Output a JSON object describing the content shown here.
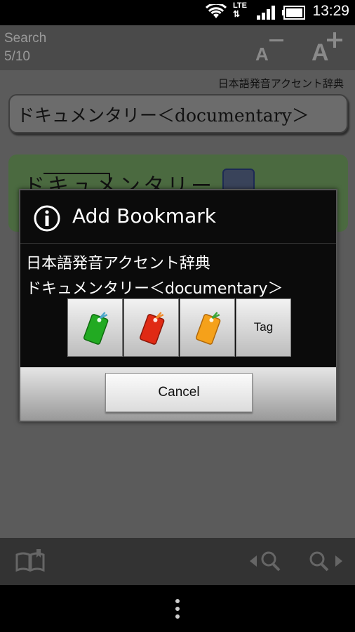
{
  "status_bar": {
    "time": "13:29",
    "network": "LTE",
    "icons": [
      "wifi-icon",
      "lte-icon",
      "signal-icon",
      "battery-icon"
    ]
  },
  "header": {
    "search_label": "Search",
    "result_position": "5/10",
    "font_decrease_icon": "font-size-decrease-icon",
    "font_increase_icon": "font-size-increase-icon"
  },
  "content": {
    "dictionary_name": "日本語発音アクセント辞典",
    "entry_word": "ドキュメンタリー＜documentary＞",
    "accent_text": "ドキュメンタリー",
    "speaker_icon": "speaker-icon"
  },
  "footer": {
    "icons": [
      "bookmark-book-icon",
      "previous-search-icon",
      "next-search-icon"
    ]
  },
  "dialog": {
    "title": "Add Bookmark",
    "dictionary_name": "日本語発音アクセント辞典",
    "entry_word": "ドキュメンタリー＜documentary＞",
    "buttons": [
      {
        "icon": "green-bookmark-icon",
        "color": "#22aa22"
      },
      {
        "icon": "red-bookmark-icon",
        "color": "#e02a14"
      },
      {
        "icon": "orange-bookmark-icon",
        "color": "#f5a11a"
      }
    ],
    "tag_label": "Tag",
    "cancel_label": "Cancel"
  },
  "colors": {
    "app_background_dimmed": "#5b5b5b",
    "accent_card": "#4b6a40",
    "dialog_background": "#0b0b0b"
  }
}
